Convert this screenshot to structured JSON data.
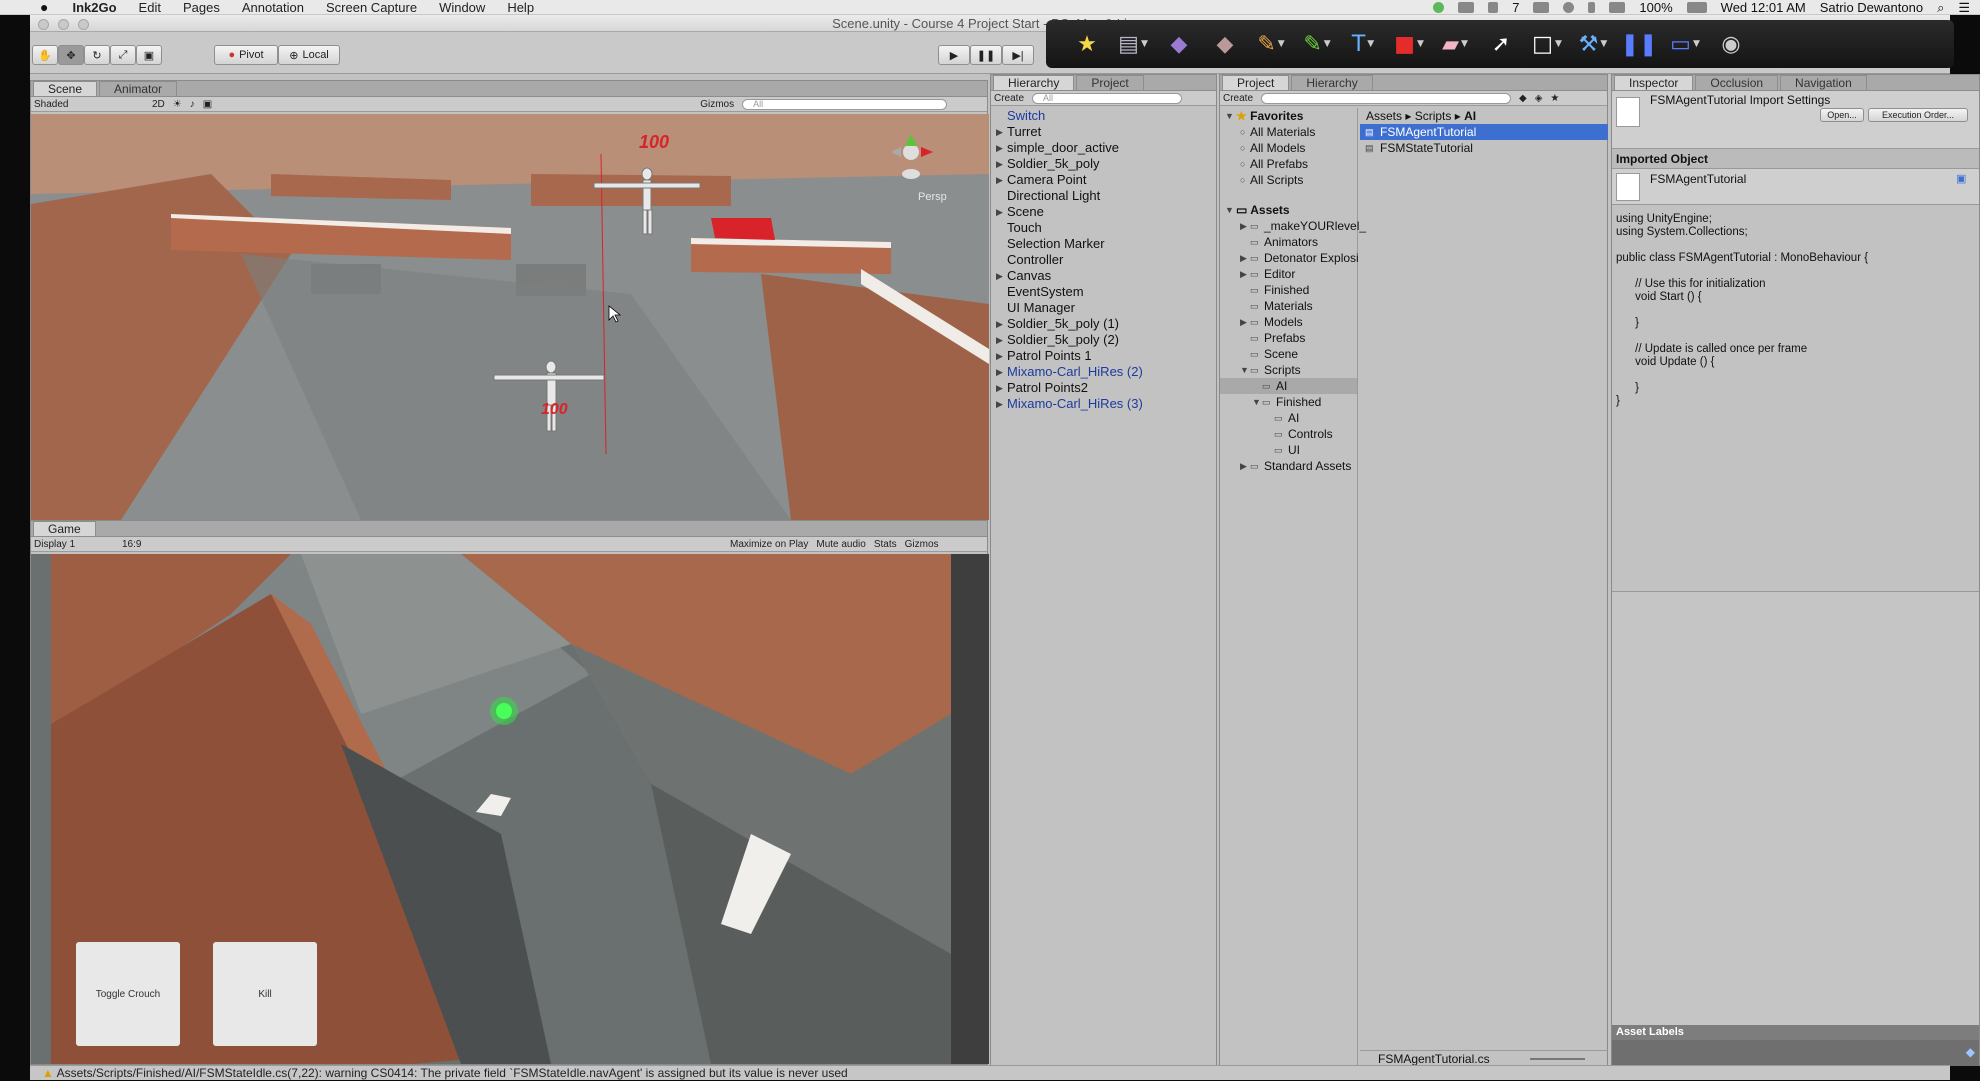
{
  "menubar": {
    "app": "Ink2Go",
    "items": [
      "Edit",
      "Pages",
      "Annotation",
      "Screen Capture",
      "Window",
      "Help"
    ],
    "battery": "100%",
    "clock": "Wed 12:01 AM",
    "user": "Satrio Dewantono",
    "notif_count": "7"
  },
  "window": {
    "title": "Scene.unity - Course 4 Project Start - PC, Mac & Linux"
  },
  "toolbar": {
    "pivot": "Pivot",
    "local": "Local"
  },
  "scene_panel": {
    "tabs": [
      "Scene",
      "Animator"
    ],
    "shading": "Shaded",
    "mode_2d": "2D",
    "gizmos": "Gizmos",
    "search_placeholder": "All",
    "persp": "Persp",
    "health_top": "100",
    "health_bottom": "100"
  },
  "game_panel": {
    "tab": "Game",
    "display": "Display 1",
    "aspect": "16:9",
    "maximize": "Maximize on Play",
    "mute": "Mute audio",
    "stats": "Stats",
    "gizmos": "Gizmos",
    "button_crouch": "Toggle Crouch",
    "button_kill": "Kill"
  },
  "hierarchy_panel": {
    "tabs": [
      "Hierarchy",
      "Project"
    ],
    "create": "Create",
    "search_placeholder": "All",
    "items": [
      {
        "label": "Switch",
        "arrow": false,
        "blue": true
      },
      {
        "label": "Turret",
        "arrow": true,
        "blue": false
      },
      {
        "label": "simple_door_active",
        "arrow": true,
        "blue": false
      },
      {
        "label": "Soldier_5k_poly",
        "arrow": true,
        "blue": false
      },
      {
        "label": "Camera Point",
        "arrow": true,
        "blue": false
      },
      {
        "label": "Directional Light",
        "arrow": false,
        "blue": false
      },
      {
        "label": "Scene",
        "arrow": true,
        "blue": false
      },
      {
        "label": "Touch",
        "arrow": false,
        "blue": false
      },
      {
        "label": "Selection Marker",
        "arrow": false,
        "blue": false
      },
      {
        "label": "Controller",
        "arrow": false,
        "blue": false
      },
      {
        "label": "Canvas",
        "arrow": true,
        "blue": false
      },
      {
        "label": "EventSystem",
        "arrow": false,
        "blue": false
      },
      {
        "label": "UI Manager",
        "arrow": false,
        "blue": false
      },
      {
        "label": "Soldier_5k_poly (1)",
        "arrow": true,
        "blue": false
      },
      {
        "label": "Soldier_5k_poly (2)",
        "arrow": true,
        "blue": false
      },
      {
        "label": "Patrol Points 1",
        "arrow": true,
        "blue": false
      },
      {
        "label": "Mixamo-Carl_HiRes (2)",
        "arrow": true,
        "blue": true
      },
      {
        "label": "Patrol Points2",
        "arrow": true,
        "blue": false
      },
      {
        "label": "Mixamo-Carl_HiRes (3)",
        "arrow": true,
        "blue": true
      }
    ]
  },
  "project_panel": {
    "tabs": [
      "Project",
      "Hierarchy"
    ],
    "create": "Create",
    "breadcrumb": [
      "Assets",
      "Scripts",
      "AI"
    ],
    "favorites_label": "Favorites",
    "favorites": [
      "All Materials",
      "All Models",
      "All Prefabs",
      "All Scripts"
    ],
    "assets_label": "Assets",
    "tree": [
      {
        "label": "_makeYOURlevel_",
        "indent": 1,
        "arrow": true
      },
      {
        "label": "Animators",
        "indent": 1,
        "arrow": false
      },
      {
        "label": "Detonator Explosi",
        "indent": 1,
        "arrow": true
      },
      {
        "label": "Editor",
        "indent": 1,
        "arrow": true
      },
      {
        "label": "Finished",
        "indent": 1,
        "arrow": false
      },
      {
        "label": "Materials",
        "indent": 1,
        "arrow": false
      },
      {
        "label": "Models",
        "indent": 1,
        "arrow": true
      },
      {
        "label": "Prefabs",
        "indent": 1,
        "arrow": false
      },
      {
        "label": "Scene",
        "indent": 1,
        "arrow": false
      },
      {
        "label": "Scripts",
        "indent": 1,
        "arrow": true
      },
      {
        "label": "AI",
        "indent": 2,
        "arrow": false,
        "selected": true
      },
      {
        "label": "Finished",
        "indent": 2,
        "arrow": true
      },
      {
        "label": "AI",
        "indent": 3,
        "arrow": false
      },
      {
        "label": "Controls",
        "indent": 3,
        "arrow": false
      },
      {
        "label": "UI",
        "indent": 3,
        "arrow": false
      },
      {
        "label": "Standard Assets",
        "indent": 1,
        "arrow": true
      }
    ],
    "files": [
      "FSMAgentTutorial",
      "FSMStateTutorial"
    ],
    "footer_file": "FSMAgentTutorial.cs"
  },
  "inspector_panel": {
    "tabs": [
      "Inspector",
      "Occlusion",
      "Navigation"
    ],
    "title": "FSMAgentTutorial Import Settings",
    "open": "Open...",
    "exec_order": "Execution Order...",
    "section": "Imported Object",
    "object_name": "FSMAgentTutorial",
    "code": "using UnityEngine;\nusing System.Collections;\n\npublic class FSMAgentTutorial : MonoBehaviour {\n\n\t// Use this for initialization\n\tvoid Start () {\n\n\t}\n\n\t// Update is called once per frame\n\tvoid Update () {\n\n\t}\n}",
    "asset_labels": "Asset Labels"
  },
  "status_bar": {
    "message": "Assets/Scripts/Finished/AI/FSMStateIdle.cs(7,22): warning CS0414: The private field `FSMStateIdle.navAgent' is assigned but its value is never used"
  },
  "colors": {
    "accent_red": "#d8232a",
    "selection": "#3d6fd1",
    "link_blue": "#1d3a9e"
  }
}
